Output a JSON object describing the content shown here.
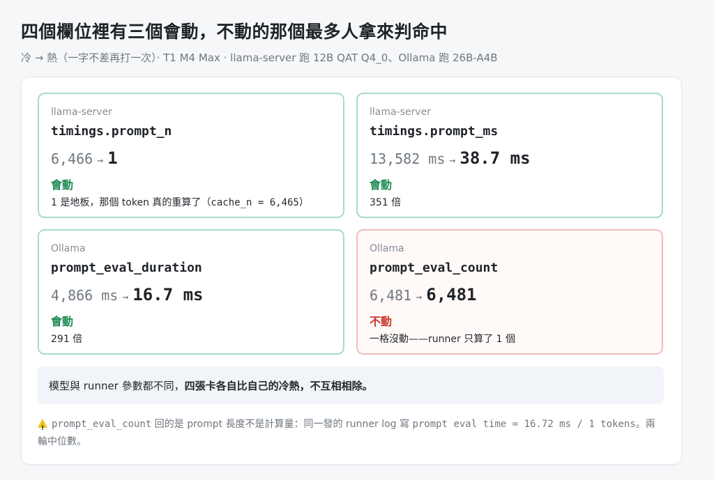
{
  "header": {
    "title": "四個欄位裡有三個會動，不動的那個最多人拿來判命中",
    "subtitle": "冷 → 熱（一字不差再打一次）· T1 M4 Max · llama-server 跑 12B QAT Q4_0、Ollama 跑 26B-A4B"
  },
  "metrics": [
    {
      "source": "llama-server",
      "field": "timings.prompt_n",
      "from": "6,466",
      "arrow": "→",
      "to": "1",
      "status": "會動",
      "status_color": "#1a8a52",
      "note_prefix": "1 是地板，那個 token 真的重算了（",
      "note_code": "cache_n = 6,465",
      "note_suffix": "）"
    },
    {
      "source": "llama-server",
      "field": "timings.prompt_ms",
      "from": "13,582 ms",
      "arrow": "→",
      "to": "38.7 ms",
      "status": "會動",
      "status_color": "#1a8a52",
      "note": "351 倍"
    },
    {
      "source": "Ollama",
      "field": "prompt_eval_duration",
      "from": "4,866 ms",
      "arrow": "→",
      "to": "16.7 ms",
      "status": "會動",
      "status_color": "#1a8a52",
      "note": "291 倍"
    },
    {
      "source": "Ollama",
      "field": "prompt_eval_count",
      "from": "6,481",
      "arrow": "→",
      "to": "6,481",
      "status": "不動",
      "status_color": "#c9362f",
      "note": "一格沒動——runner 只算了 1 個"
    }
  ],
  "callout": {
    "plain": "模型與 runner 參數都不同，",
    "bold": "四張卡各自比自己的冷熱，不互相相除。"
  },
  "footnote": {
    "icon": "warning-icon",
    "code1": "prompt_eval_count",
    "text1": " 回的是 prompt 長度不是計算量：同一發的 runner log 寫 ",
    "code2": "prompt eval time = 16.72 ms / 1 tokens",
    "text2": "。兩輪中位數。"
  },
  "colors": {
    "ok_border": "#a8dcc4",
    "bad_border": "#f0bcbc",
    "ok_text": "#1a8a52",
    "bad_text": "#c9362f"
  }
}
